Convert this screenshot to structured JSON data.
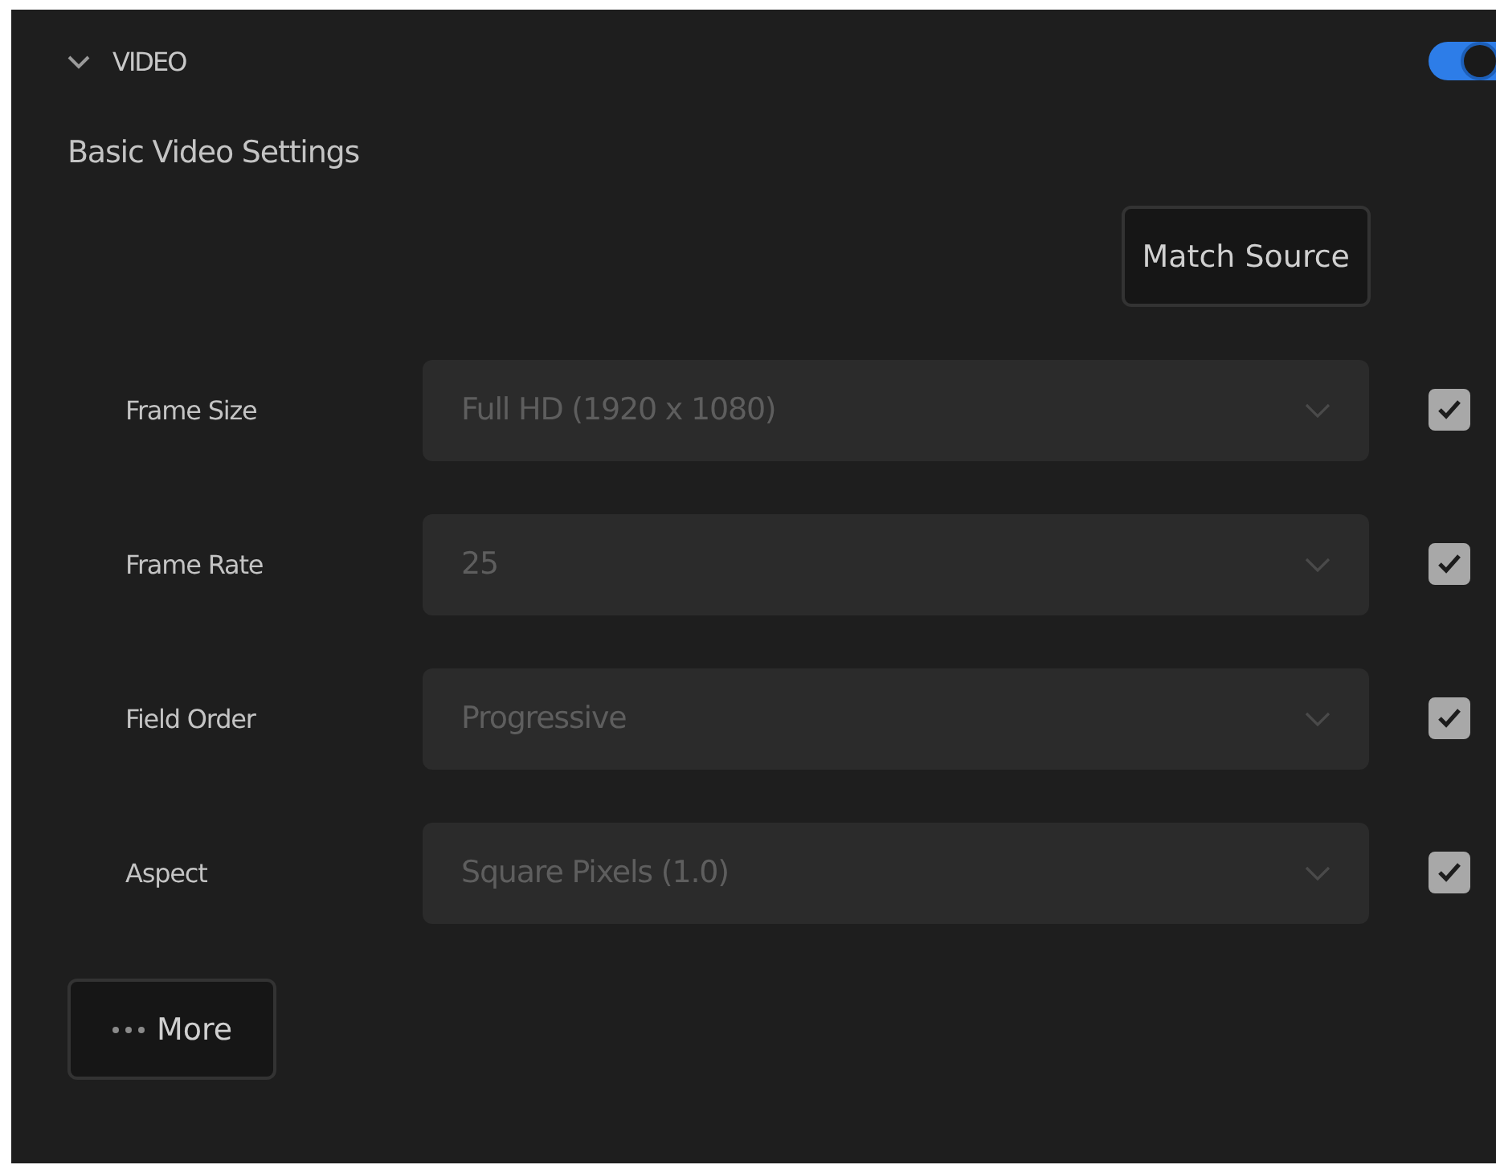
{
  "section": {
    "title": "VIDEO",
    "expanded": true,
    "enabled": true
  },
  "heading": "Basic Video Settings",
  "match_button": "Match Source",
  "rows": [
    {
      "label": "Frame Size",
      "value": "Full HD (1920 x 1080)",
      "checked": true
    },
    {
      "label": "Frame Rate",
      "value": "25",
      "checked": true
    },
    {
      "label": "Field Order",
      "value": "Progressive",
      "checked": true
    },
    {
      "label": "Aspect",
      "value": "Square Pixels (1.0)",
      "checked": true
    }
  ],
  "more_button": "More"
}
